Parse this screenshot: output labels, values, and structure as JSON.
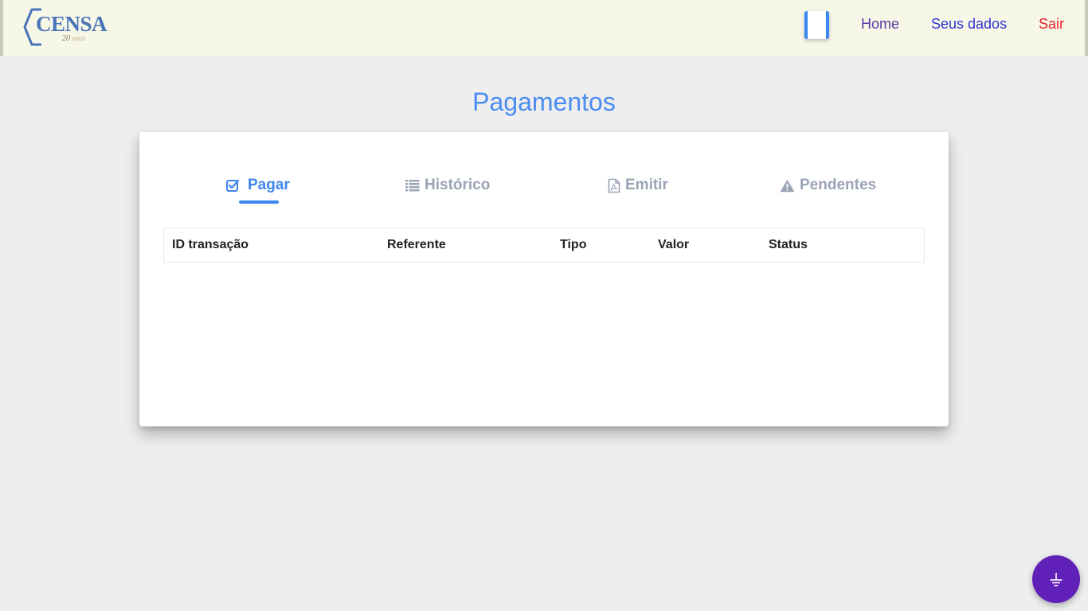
{
  "header": {
    "logo": {
      "text": "CENSA",
      "subtitle_number": "20",
      "subtitle_word": "anos"
    },
    "nav": {
      "home": "Home",
      "seus_dados": "Seus dados",
      "sair": "Sair"
    }
  },
  "page": {
    "title": "Pagamentos"
  },
  "tabs": [
    {
      "label": "Pagar",
      "icon": "check-square-icon",
      "active": true
    },
    {
      "label": "Histórico",
      "icon": "list-icon",
      "active": false
    },
    {
      "label": "Emitir",
      "icon": "pdf-file-icon",
      "active": false
    },
    {
      "label": "Pendentes",
      "icon": "warning-icon",
      "active": false
    }
  ],
  "table": {
    "columns": [
      "ID transação",
      "Referente",
      "Tipo",
      "Valor",
      "Status"
    ],
    "rows": []
  },
  "fab": {
    "icon": "ground-icon"
  },
  "colors": {
    "accent": "#3e86ef",
    "header_bg": "#f7f7e8",
    "page_bg": "#eeeeee",
    "tab_inactive": "#9aa3b5",
    "home_link": "#5b3aa6",
    "dados_link": "#2e33d0",
    "sair_link": "#e8232a",
    "fab_bg": "#6120b8"
  }
}
